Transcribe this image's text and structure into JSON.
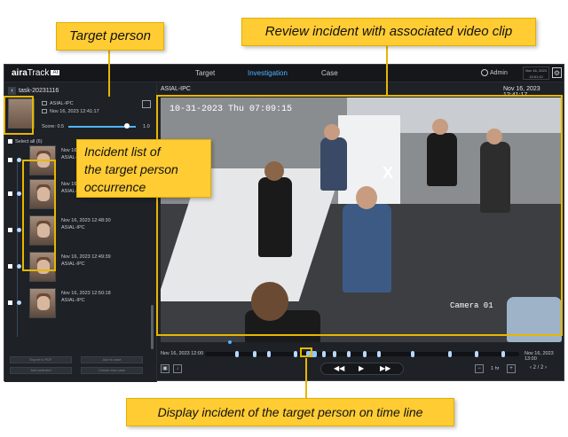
{
  "callouts": {
    "target_person": "Target person",
    "review_incident": "Review incident with associated video clip",
    "incident_list": "Incident list of\nthe target person\noccurrence",
    "display_incident": "Display incident of the target person on time line"
  },
  "app": {
    "logo_part1": "aira",
    "logo_part2": "Track",
    "logo_badge": "AI",
    "tabs": [
      "Target",
      "Investigation",
      "Case"
    ],
    "active_tab": "Investigation",
    "user": "Admin",
    "clock_line1": "Nov 16, 2023",
    "clock_line2": "13:01:12"
  },
  "left_panel": {
    "task_name": "task-20231116",
    "camera": "ASIAL-IPC",
    "target_time": "Nov 16, 2023 12:41:17",
    "score_label": "Score:",
    "score_min": "0.5",
    "score_max": "1.0",
    "select_all": "Select all (6)",
    "incidents": [
      {
        "time": "Nov 16, 2023 12:44:53",
        "camera": "ASIAL-IPC"
      },
      {
        "time": "Nov 16, 2023 12:47:52",
        "camera": "ASIAL-IPC"
      },
      {
        "time": "Nov 16, 2023 12:48:30",
        "camera": "ASIAL-IPC"
      },
      {
        "time": "Nov 16, 2023 12:49:39",
        "camera": "ASIAL-IPC"
      },
      {
        "time": "Nov 16, 2023 12:50:18",
        "camera": "ASIAL-IPC"
      }
    ],
    "buttons": [
      "Export to PDF",
      "Add to case",
      "Add selected",
      "Create new case"
    ]
  },
  "video": {
    "camera_label": "ASIAL-IPC",
    "timestamp": "Nov 16, 2023 12:41:17",
    "osd_time": "10-31-2023 Thu 07:09:15",
    "osd_camera": "Camera 01"
  },
  "timeline": {
    "start": "Nov 16, 2023 12:00",
    "end": "Nov 16, 2023 13:00",
    "speed": "1 hr",
    "page": "2 / 2"
  },
  "icons": {
    "back": "chevron-left-icon",
    "settings": "gear-icon",
    "user": "user-icon"
  },
  "colors": {
    "accent": "#4fb4ff",
    "highlight": "#e7b600",
    "callout_bg": "#ffcc33",
    "app_bg": "#1e2126"
  }
}
